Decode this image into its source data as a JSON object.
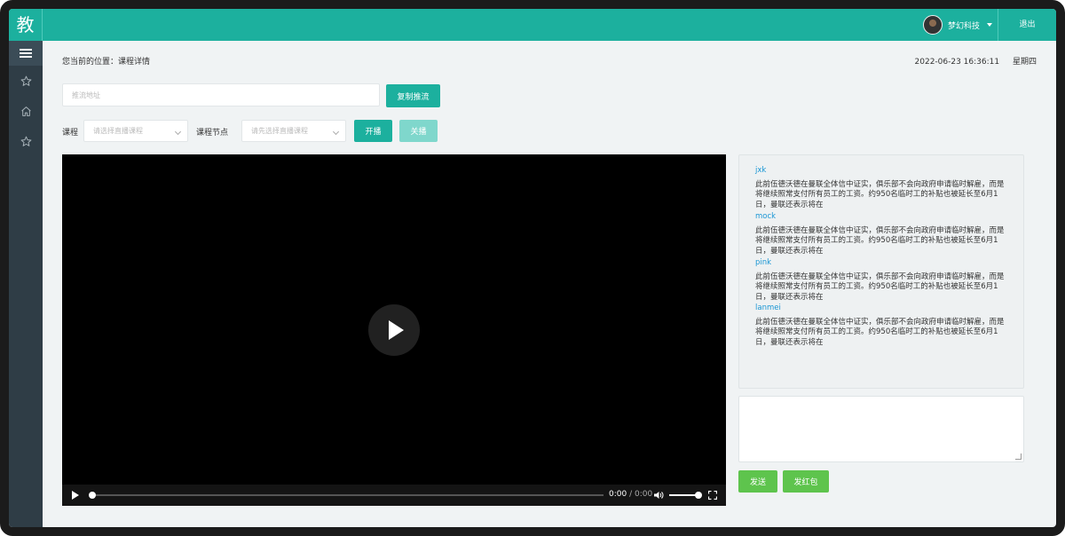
{
  "header": {
    "logo": "教",
    "user_name": "梦幻科技",
    "logout_label": "退出"
  },
  "breadcrumb": "您当前的位置：课程详情",
  "datetime": {
    "date": "2022-06-23 16:36:11",
    "weekday": "星期四"
  },
  "stream": {
    "placeholder": "推流地址",
    "copy_button": "复制推流"
  },
  "filters": {
    "course_label": "课程",
    "course_placeholder": "请选择直播课程",
    "node_label": "课程节点",
    "node_placeholder": "请先选择直播课程",
    "start_button": "开播",
    "stop_button": "关播"
  },
  "player": {
    "time_current": "0:00",
    "time_separator": " / ",
    "time_total": "0:00",
    "progress": 0,
    "volume": 1.0
  },
  "chat": {
    "messages": [
      {
        "user": "jxk",
        "text": "此前伍德沃德在曼联全体信中证实，俱乐部不会向政府申请临时解雇，而是将继续照常支付所有员工的工资。约950名临时工的补贴也被延长至6月1日，曼联还表示将在"
      },
      {
        "user": "mock",
        "text": "此前伍德沃德在曼联全体信中证实，俱乐部不会向政府申请临时解雇，而是将继续照常支付所有员工的工资。约950名临时工的补贴也被延长至6月1日，曼联还表示将在"
      },
      {
        "user": "pink",
        "text": "此前伍德沃德在曼联全体信中证实，俱乐部不会向政府申请临时解雇，而是将继续照常支付所有员工的工资。约950名临时工的补贴也被延长至6月1日，曼联还表示将在"
      },
      {
        "user": "lanmei",
        "text": "此前伍德沃德在曼联全体信中证实，俱乐部不会向政府申请临时解雇，而是将继续照常支付所有员工的工资。约950名临时工的补贴也被延长至6月1日，曼联还表示将在"
      }
    ],
    "send_button": "发送",
    "red_packet_button": "发红包"
  },
  "colors": {
    "primary": "#1cb09e",
    "primary_disabled": "#7fd7cc",
    "send": "#5ec44d",
    "sidebar": "#2f3d46",
    "chat_username": "#1a96d4"
  },
  "sidebar_icons": [
    "menu-icon",
    "star-icon",
    "home-icon",
    "star-icon"
  ]
}
